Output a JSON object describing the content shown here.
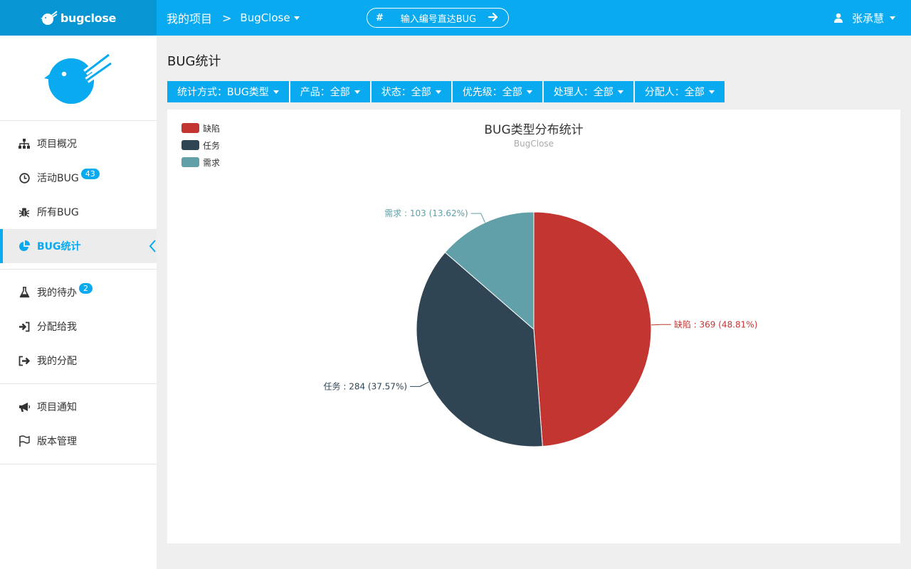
{
  "topbar": {
    "brand": "bugclose",
    "crumb_main": "我的项目",
    "crumb_sep": ">",
    "project": "BugClose",
    "search_placeholder": "输入编号直达BUG",
    "search_hash": "#",
    "user": "张承慧"
  },
  "sidebar": {
    "groups": [
      [
        {
          "label": "项目概况",
          "icon": "sitemap-icon"
        },
        {
          "label": "活动BUG",
          "icon": "clock-icon",
          "badge": "43"
        },
        {
          "label": "所有BUG",
          "icon": "bug-icon"
        },
        {
          "label": "BUG统计",
          "icon": "pie-chart-icon",
          "active": true
        }
      ],
      [
        {
          "label": "我的待办",
          "icon": "flask-icon",
          "badge": "2"
        },
        {
          "label": "分配给我",
          "icon": "sign-in-icon"
        },
        {
          "label": "我的分配",
          "icon": "sign-out-icon"
        }
      ],
      [
        {
          "label": "项目通知",
          "icon": "bullhorn-icon"
        },
        {
          "label": "版本管理",
          "icon": "flag-icon"
        }
      ]
    ]
  },
  "main": {
    "title": "BUG统计",
    "filters": [
      "统计方式：BUG类型",
      "产品：全部",
      "状态：全部",
      "优先级：全部",
      "处理人：全部",
      "分配人：全部"
    ]
  },
  "chart_data": {
    "type": "pie",
    "title": "BUG类型分布统计",
    "subtitle": "BugClose",
    "legend_position": "top-left",
    "slices": [
      {
        "name": "缺陷",
        "value": 369,
        "percent": "48.81%",
        "color": "#c23531"
      },
      {
        "name": "任务",
        "value": 284,
        "percent": "37.57%",
        "color": "#2f4554"
      },
      {
        "name": "需求",
        "value": 103,
        "percent": "13.62%",
        "color": "#61a0a8"
      }
    ]
  },
  "colors": {
    "accent": "#0aaaf0",
    "brand_dark": "#0895d4"
  }
}
